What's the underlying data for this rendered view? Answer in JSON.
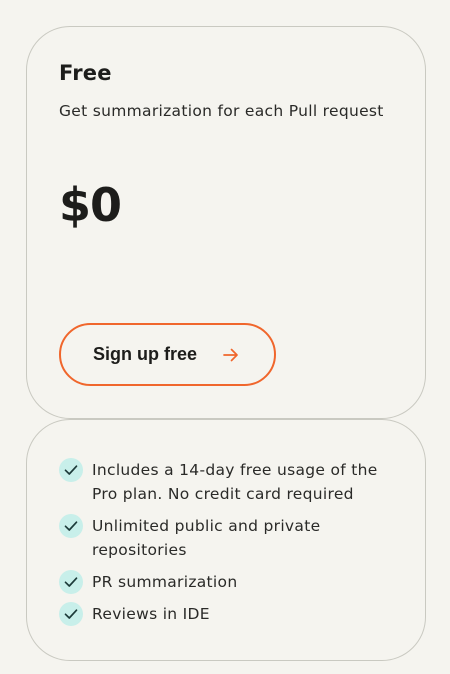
{
  "plan": {
    "name": "Free",
    "description": "Get summarization for each Pull request",
    "price": "$0",
    "cta_label": "Sign up free"
  },
  "features": [
    "Includes a 14-day free usage of the Pro plan. No credit card required",
    "Unlimited public and private repositories",
    "PR summarization",
    "Reviews in IDE"
  ],
  "colors": {
    "accent": "#f0662c",
    "check_bg": "#c8efea",
    "check_mark": "#1d3b3a",
    "card_border": "#c9c9c1",
    "background": "#f5f4ef"
  },
  "icons": {
    "cta": "arrow-right-icon",
    "feature": "check-icon"
  }
}
